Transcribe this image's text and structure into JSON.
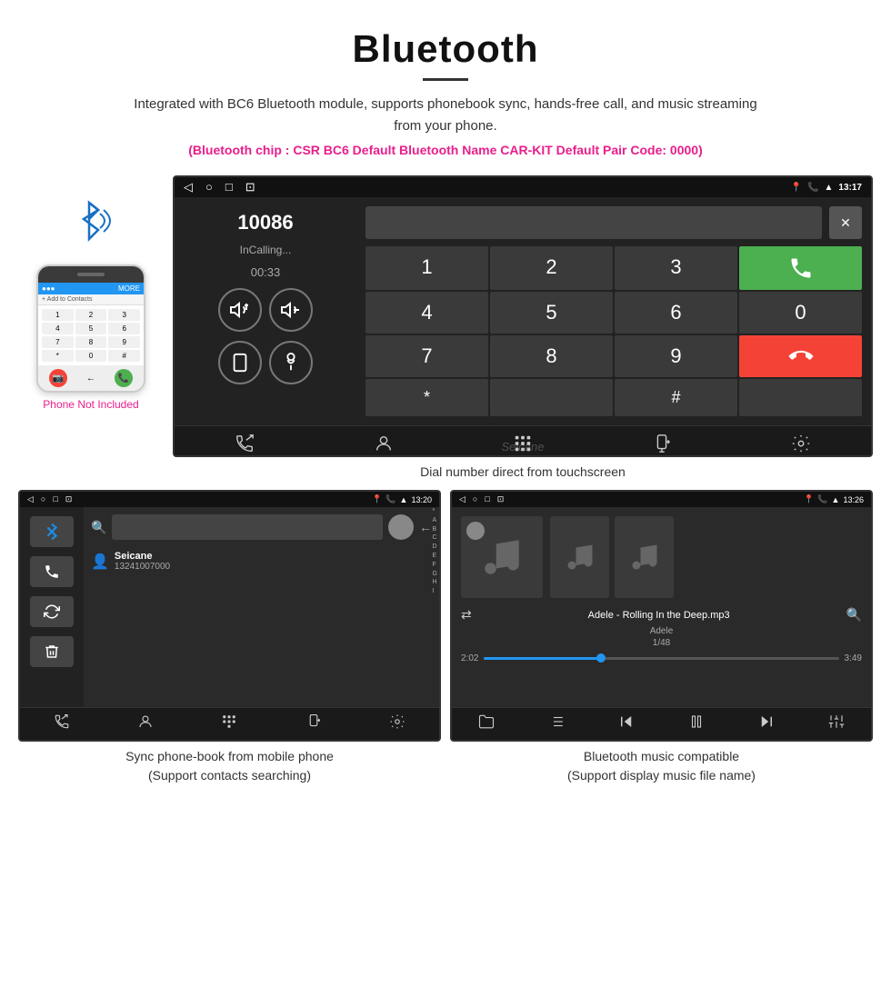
{
  "header": {
    "title": "Bluetooth",
    "description": "Integrated with BC6 Bluetooth module, supports phonebook sync, hands-free call, and music streaming from your phone.",
    "specs": "(Bluetooth chip : CSR BC6    Default Bluetooth Name CAR-KIT    Default Pair Code: 0000)"
  },
  "phone_illustration": {
    "label": "Phone Not Included"
  },
  "car_screen": {
    "status_bar": {
      "nav_icons": "◁  ○  □  ⊘",
      "time": "13:17"
    },
    "dialer_number": "10086",
    "dialer_status": "InCalling...",
    "dialer_timer": "00:33",
    "numpad": [
      "1",
      "2",
      "3",
      "*",
      "4",
      "5",
      "6",
      "0",
      "7",
      "8",
      "9",
      "#"
    ],
    "watermark": "Seicane"
  },
  "dial_label": "Dial number direct from touchscreen",
  "phonebook_screen": {
    "status_bar_time": "13:20",
    "contact_name": "Seicane",
    "contact_number": "13241007000",
    "alphabet": [
      "*",
      "A",
      "B",
      "C",
      "D",
      "E",
      "F",
      "G",
      "H",
      "I"
    ]
  },
  "phonebook_label": {
    "line1": "Sync phone-book from mobile phone",
    "line2": "(Support contacts searching)"
  },
  "music_screen": {
    "status_bar_time": "13:26",
    "song_title": "Adele - Rolling In the Deep.mp3",
    "artist": "Adele",
    "track_info": "1/48",
    "time_current": "2:02",
    "time_total": "3:49"
  },
  "music_label": {
    "line1": "Bluetooth music compatible",
    "line2": "(Support display music file name)"
  },
  "toolbar_icons": {
    "calls": "📞",
    "contacts": "👤",
    "dialpad": "⠿",
    "transfer": "📱",
    "settings": "⚙"
  }
}
